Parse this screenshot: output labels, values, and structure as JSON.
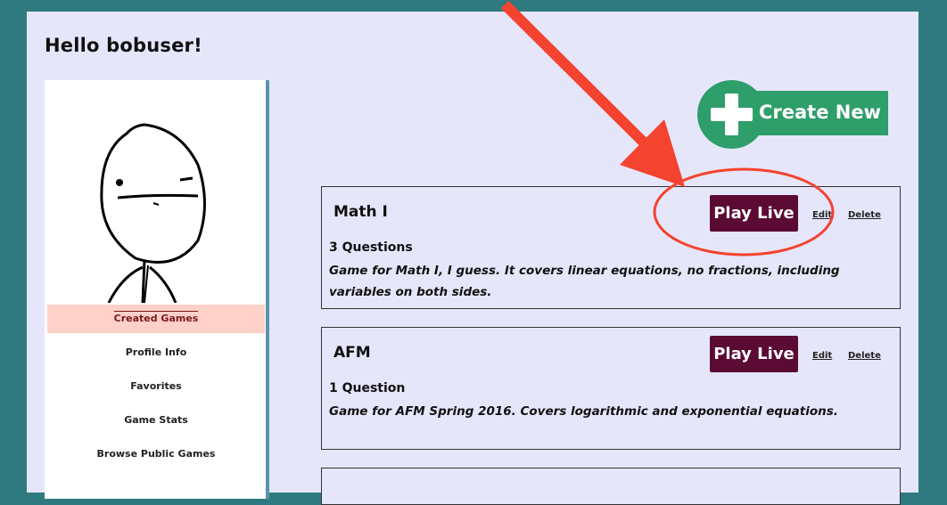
{
  "header": {
    "greeting": "Hello bobuser!"
  },
  "sidebar": {
    "avatar_icon": "meme-face-avatar",
    "items": [
      {
        "label": "Created Games",
        "active": true
      },
      {
        "label": "Profile Info",
        "active": false
      },
      {
        "label": "Favorites",
        "active": false
      },
      {
        "label": "Game Stats",
        "active": false
      },
      {
        "label": "Browse Public Games",
        "active": false
      }
    ]
  },
  "main": {
    "create_label": "Create New",
    "create_icon": "plus-icon",
    "games": [
      {
        "title": "Math I",
        "count": "3 Questions",
        "description": "Game for Math I, I guess. It covers linear equations, no fractions, including variables on both sides.",
        "play_label": "Play Live",
        "edit_label": "Edit",
        "delete_label": "Delete"
      },
      {
        "title": "AFM",
        "count": "1 Question",
        "description": "Game for AFM Spring 2016. Covers logarithmic and exponential equations.",
        "play_label": "Play Live",
        "edit_label": "Edit",
        "delete_label": "Delete"
      }
    ]
  },
  "colors": {
    "background": "#2f7a80",
    "panel": "#e6e6fb",
    "create_green": "#2e9e6a",
    "play_maroon": "#5b0b33",
    "active_nav": "#fdd0c8",
    "annotation_red": "#f4432e"
  },
  "annotation": {
    "arrow_icon": "red-arrow",
    "circle_icon": "red-circle-highlight"
  }
}
